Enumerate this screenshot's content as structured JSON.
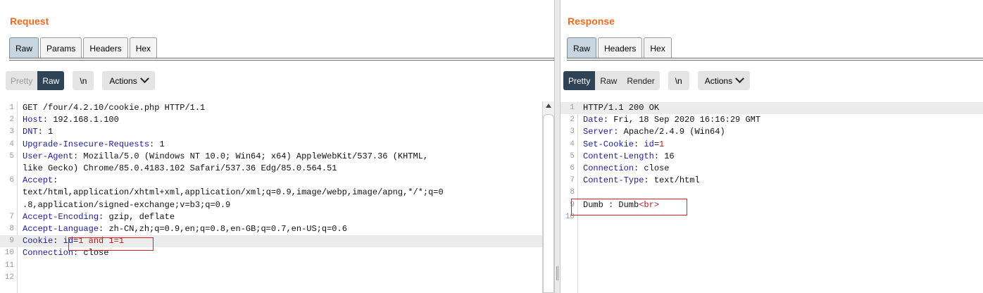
{
  "request": {
    "title": "Request",
    "tabs": [
      {
        "label": "Raw",
        "active": true
      },
      {
        "label": "Params",
        "active": false
      },
      {
        "label": "Headers",
        "active": false
      },
      {
        "label": "Hex",
        "active": false
      }
    ],
    "view_modes": {
      "pretty": "Pretty",
      "raw": "Raw"
    },
    "newline_button": "\\n",
    "actions_label": "Actions",
    "lines": [
      {
        "n": "1",
        "key": "",
        "sep": "",
        "val": "GET /four/4.2.10/cookie.php HTTP/1.1"
      },
      {
        "n": "2",
        "key": "Host",
        "sep": ": ",
        "val": "192.168.1.100"
      },
      {
        "n": "3",
        "key": "DNT",
        "sep": ": ",
        "val": "1"
      },
      {
        "n": "4",
        "key": "Upgrade-Insecure-Requests",
        "sep": ": ",
        "val": "1"
      },
      {
        "n": "5",
        "key": "User-Agent",
        "sep": ": ",
        "val": "Mozilla/5.0 (Windows NT 10.0; Win64; x64) AppleWebKit/537.36 (KHTML,"
      },
      {
        "n": "",
        "key": "",
        "sep": "",
        "val": "like Gecko) Chrome/85.0.4183.102 Safari/537.36 Edg/85.0.564.51"
      },
      {
        "n": "6",
        "key": "Accept",
        "sep": ":",
        "val": ""
      },
      {
        "n": "",
        "key": "",
        "sep": "",
        "val": "text/html,application/xhtml+xml,application/xml;q=0.9,image/webp,image/apng,*/*;q=0"
      },
      {
        "n": "",
        "key": "",
        "sep": "",
        "val": ".8,application/signed-exchange;v=b3;q=0.9"
      },
      {
        "n": "7",
        "key": "Accept-Encoding",
        "sep": ": ",
        "val": "gzip, deflate"
      },
      {
        "n": "8",
        "key": "Accept-Language",
        "sep": ": ",
        "val": "zh-CN,zh;q=0.9,en;q=0.8,en-GB;q=0.7,en-US;q=0.6"
      },
      {
        "n": "9",
        "key": "Cookie",
        "sep": ": ",
        "val": "",
        "cookie_name": "id",
        "cookie_eq": "=",
        "cookie_value": "1 and 1=1"
      },
      {
        "n": "10",
        "key": "Connection",
        "sep": ": ",
        "val": "close"
      },
      {
        "n": "11",
        "key": "",
        "sep": "",
        "val": ""
      },
      {
        "n": "12",
        "key": "",
        "sep": "",
        "val": ""
      }
    ]
  },
  "response": {
    "title": "Response",
    "tabs": [
      {
        "label": "Raw",
        "active": true
      },
      {
        "label": "Headers",
        "active": false
      },
      {
        "label": "Hex",
        "active": false
      }
    ],
    "view_modes": {
      "pretty": "Pretty",
      "raw": "Raw",
      "render": "Render"
    },
    "newline_button": "\\n",
    "actions_label": "Actions",
    "lines": [
      {
        "n": "1",
        "key": "",
        "sep": "",
        "val": "HTTP/1.1 200 OK"
      },
      {
        "n": "2",
        "key": "Date",
        "sep": ": ",
        "val": "Fri, 18 Sep 2020 16:16:29 GMT"
      },
      {
        "n": "3",
        "key": "Server",
        "sep": ": ",
        "val": "Apache/2.4.9 (Win64)"
      },
      {
        "n": "4",
        "key": "Set-Cookie",
        "sep": ": ",
        "val": "",
        "cookie_name": "id",
        "cookie_eq": "=",
        "cookie_value": "1"
      },
      {
        "n": "5",
        "key": "Content-Length",
        "sep": ": ",
        "val": "16"
      },
      {
        "n": "6",
        "key": "Connection",
        "sep": ": ",
        "val": "close"
      },
      {
        "n": "7",
        "key": "Content-Type",
        "sep": ": ",
        "val": "text/html"
      },
      {
        "n": "8",
        "key": "",
        "sep": "",
        "val": ""
      },
      {
        "n": "9",
        "key": "",
        "sep": "",
        "val": "Dumb : Dumb",
        "tag": "<br>"
      },
      {
        "n": "10",
        "key": "",
        "sep": "",
        "val": ""
      }
    ]
  },
  "colors": {
    "accent": "#f26a21",
    "active_button": "#2e4356",
    "active_tab": "#c8d6e2",
    "highlight_box": "#dd2222"
  }
}
